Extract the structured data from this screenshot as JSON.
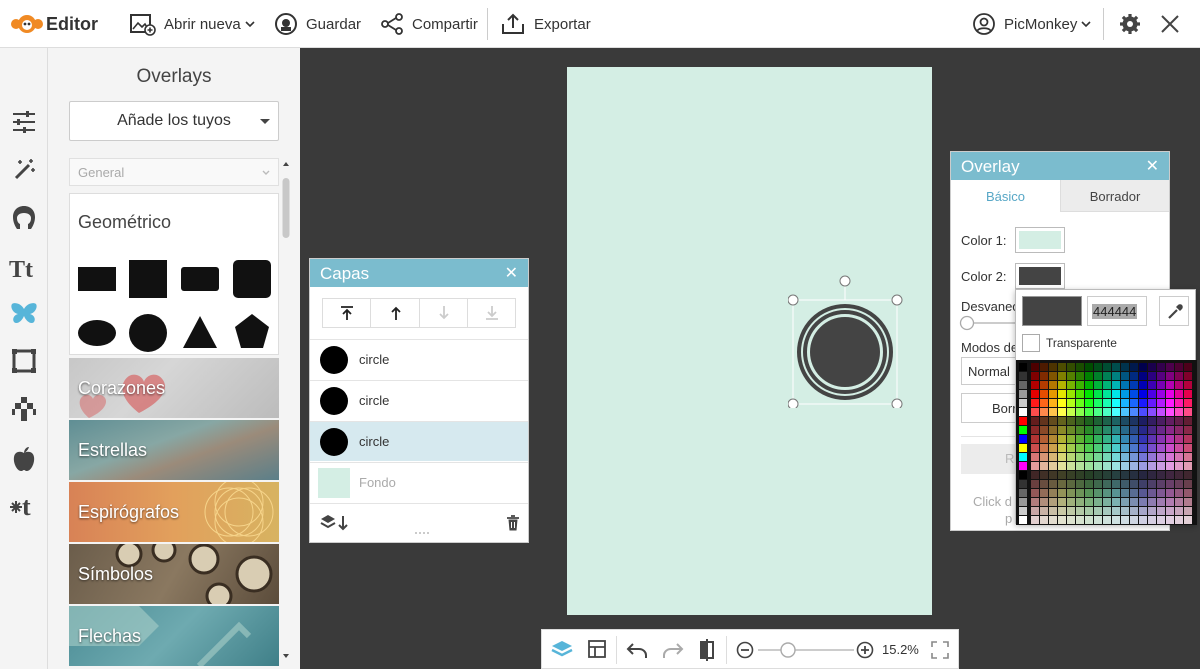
{
  "app": {
    "name": "Editor"
  },
  "toolbar": {
    "open_label": "Abrir nueva",
    "save_label": "Guardar",
    "share_label": "Compartir",
    "export_label": "Exportar",
    "account_label": "PicMonkey"
  },
  "panel": {
    "title": "Overlays",
    "add_label": "Añade los tuyos",
    "group_label": "General",
    "geometric_title": "Geométrico",
    "categories": [
      "Corazones",
      "Estrellas",
      "Espirógrafos",
      "Símbolos",
      "Flechas"
    ]
  },
  "layers": {
    "title": "Capas",
    "items": [
      "circle",
      "circle",
      "circle",
      "Fondo"
    ],
    "selected_index": 2
  },
  "overlay": {
    "title": "Overlay",
    "tab_basic": "Básico",
    "tab_eraser": "Borrador",
    "color1_label": "Color 1:",
    "color2_label": "Color 2:",
    "fade_label": "Desvaneo",
    "blend_label": "Modos de",
    "blend_value": "Normal",
    "erase_btn": "Borr",
    "hint_a": "Click d",
    "hint_b": "p",
    "r_label": "R"
  },
  "picker": {
    "hex_value": "444444",
    "transparent_label": "Transparente"
  },
  "zoom": {
    "value": "15.2%"
  },
  "colors": {
    "accent": "#7bbcce",
    "canvas": "#d4eee4",
    "color1": "#d4eee4",
    "color2": "#444444",
    "brand_orange": "#f08a24",
    "rail_icon": "#444444",
    "rail_icon_active": "#57b5d9"
  }
}
